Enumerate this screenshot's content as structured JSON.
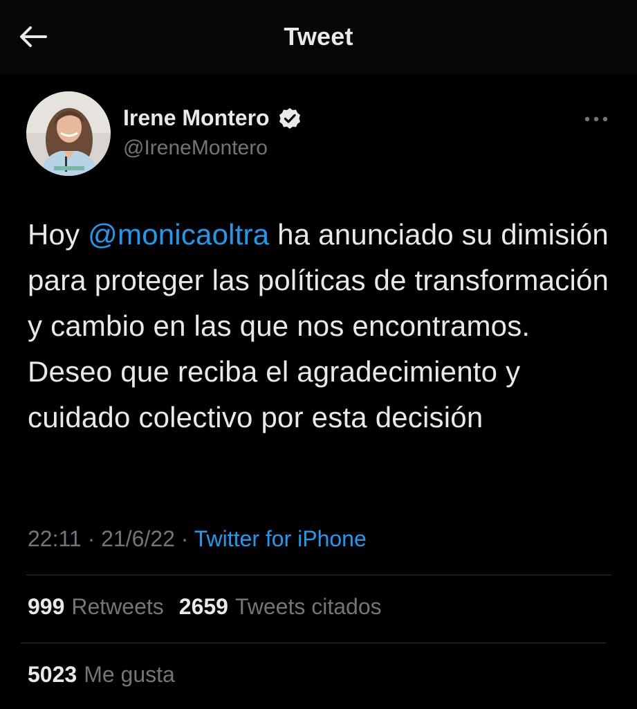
{
  "header": {
    "title": "Tweet",
    "back_icon": "arrow-left-icon"
  },
  "author": {
    "name": "Irene Montero",
    "handle": "@IreneMontero",
    "verified": true,
    "verified_icon": "verified-badge-icon",
    "more_icon": "more-horizontal-icon"
  },
  "tweet": {
    "text_before": "Hoy ",
    "mention": "@monicaoltra",
    "text_after": " ha anunciado su dimisión para proteger las políticas de transformación y cambio en las que nos encontramos. Deseo que reciba el agradecimiento y cuidado colectivo por esta decisión"
  },
  "meta": {
    "time": "22:11",
    "separator1": " · ",
    "date": "21/6/22",
    "separator2": " · ",
    "source": "Twitter for iPhone"
  },
  "stats": {
    "retweets_count": "999",
    "retweets_label": "Retweets",
    "quotes_count": "2659",
    "quotes_label": "Tweets citados",
    "likes_count": "5023",
    "likes_label": "Me gusta"
  },
  "colors": {
    "background": "#000000",
    "text": "#e7e9ea",
    "secondary": "#71767b",
    "accent": "#1d9bf0",
    "divider": "#2f3336"
  }
}
